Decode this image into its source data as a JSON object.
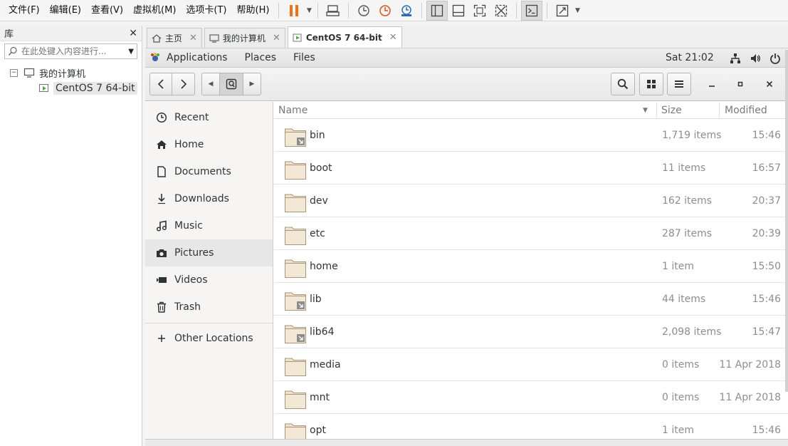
{
  "menubar": {
    "items": [
      "文件(F)",
      "编辑(E)",
      "查看(V)",
      "虚拟机(M)",
      "选项卡(T)",
      "帮助(H)"
    ]
  },
  "library": {
    "title": "库",
    "search_placeholder": "在此处键入内容进行...",
    "tree": {
      "root_label": "我的计算机",
      "vm_label": "CentOS 7 64-bit"
    }
  },
  "vm_tabs": [
    {
      "label": "主页",
      "icon": "home-icon"
    },
    {
      "label": "我的计算机",
      "icon": "computer-icon"
    },
    {
      "label": "CentOS 7 64-bit",
      "icon": "vm-icon"
    }
  ],
  "gnome": {
    "menus": [
      "Applications",
      "Places",
      "Files"
    ],
    "clock": "Sat 21:02"
  },
  "sidebar": {
    "items": [
      {
        "label": "Recent",
        "icon": "clock-icon"
      },
      {
        "label": "Home",
        "icon": "home-icon"
      },
      {
        "label": "Documents",
        "icon": "document-icon"
      },
      {
        "label": "Downloads",
        "icon": "download-icon"
      },
      {
        "label": "Music",
        "icon": "music-icon"
      },
      {
        "label": "Pictures",
        "icon": "camera-icon"
      },
      {
        "label": "Videos",
        "icon": "video-icon"
      },
      {
        "label": "Trash",
        "icon": "trash-icon"
      }
    ],
    "other_locations": "Other Locations"
  },
  "filelist": {
    "columns": {
      "name": "Name",
      "size": "Size",
      "modified": "Modified"
    },
    "rows": [
      {
        "name": "bin",
        "size": "1,719 items",
        "modified": "15:46",
        "link": true
      },
      {
        "name": "boot",
        "size": "11 items",
        "modified": "16:57",
        "link": false
      },
      {
        "name": "dev",
        "size": "162 items",
        "modified": "20:37",
        "link": false
      },
      {
        "name": "etc",
        "size": "287 items",
        "modified": "20:39",
        "link": false
      },
      {
        "name": "home",
        "size": "1 item",
        "modified": "15:50",
        "link": false
      },
      {
        "name": "lib",
        "size": "44 items",
        "modified": "15:46",
        "link": true
      },
      {
        "name": "lib64",
        "size": "2,098 items",
        "modified": "15:47",
        "link": true
      },
      {
        "name": "media",
        "size": "0 items",
        "modified": "11 Apr 2018",
        "link": false
      },
      {
        "name": "mnt",
        "size": "0 items",
        "modified": "11 Apr 2018",
        "link": false
      },
      {
        "name": "opt",
        "size": "1 item",
        "modified": "15:46",
        "link": false
      }
    ]
  },
  "colors": {
    "pause_orange": "#e8731c",
    "folder_fill": "#efe3cf",
    "folder_stroke": "#a8957a",
    "vm_green": "#4caa3c"
  }
}
